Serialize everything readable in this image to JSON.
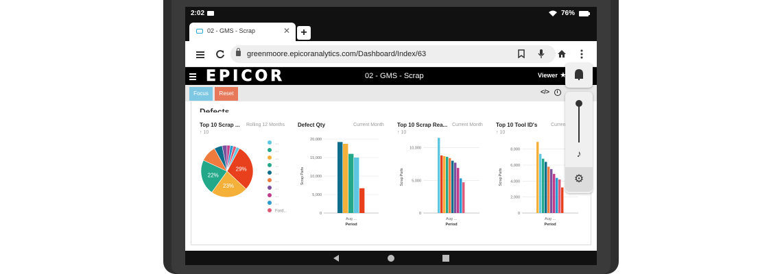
{
  "status": {
    "time": "2:02",
    "battery": "76%"
  },
  "browser": {
    "tab_title": "02 - GMS - Scrap",
    "tab_close": "✕",
    "new_tab": "+",
    "url": "greenmoore.epicoranalytics.com/Dashboard/Index/63"
  },
  "app": {
    "logo": "EPICOR",
    "title": "02 - GMS - Scrap",
    "viewer": "Viewer",
    "focus_label": "Focus",
    "reset_label": "Reset",
    "code_label": "</>"
  },
  "section_title": "Defects",
  "cards": [
    {
      "title": "Top 10 Scrap ...",
      "subtitle": "Rolling 12 Months",
      "count": "10"
    },
    {
      "title": "Defect Qty",
      "subtitle": "Current Month",
      "count": ""
    },
    {
      "title": "Top 10 Scrap Rea...",
      "subtitle": "Current Month",
      "count": "10"
    },
    {
      "title": "Top 10 Tool ID's",
      "subtitle": "Curren",
      "count": "10"
    }
  ],
  "chart_data": [
    {
      "type": "pie",
      "title": "Top 10 Scrap ...",
      "values": [
        29,
        23,
        22,
        10,
        5,
        3,
        2,
        2,
        2,
        2
      ],
      "colors": [
        "#e8401c",
        "#f5b03a",
        "#23a88a",
        "#f07b3f",
        "#0e6e8c",
        "#7d4f9c",
        "#c23b8a",
        "#2a9bd1",
        "#df5a76",
        "#5ec6e0"
      ],
      "data_labels": [
        "29%",
        "23%",
        "22%"
      ],
      "legend": [
        "...",
        "...",
        "...",
        "...",
        "...",
        "...",
        "...",
        "...",
        "...",
        "Ford..."
      ],
      "legend_colors": [
        "#5ec6e0",
        "#23a88a",
        "#f5b03a",
        "#23a88a",
        "#0e6e8c",
        "#f07b3f",
        "#7d4f9c",
        "#c23b8a",
        "#2a9bd1",
        "#df5a76"
      ]
    },
    {
      "type": "bar",
      "title": "Defect Qty",
      "categories": [
        "Aug ..."
      ],
      "values": [
        19200,
        18700,
        16000,
        15000,
        6700
      ],
      "colors": [
        "#0e6e8c",
        "#f5b03a",
        "#23a88a",
        "#5ec6e0",
        "#e8401c"
      ],
      "xlabel": "Period",
      "ylabel": "Scrap Parts",
      "ylim": [
        0,
        20000
      ],
      "yticks": [
        "0",
        "5,000",
        "10,000",
        "15,000",
        "20,000"
      ]
    },
    {
      "type": "bar",
      "title": "Top 10 Scrap Rea...",
      "categories": [
        "Aug ..."
      ],
      "values": [
        11500,
        8800,
        8700,
        8600,
        8400,
        8000,
        7700,
        6900,
        5300,
        4700
      ],
      "colors": [
        "#5ec6e0",
        "#e8401c",
        "#f5b03a",
        "#23a88a",
        "#f07b3f",
        "#0e6e8c",
        "#7d4f9c",
        "#c23b8a",
        "#2a9bd1",
        "#df5a76"
      ],
      "xlabel": "Period",
      "ylabel": "Scrap Parts",
      "ylim": [
        0,
        11000
      ],
      "yticks": [
        "0",
        "5,000",
        "10,000"
      ]
    },
    {
      "type": "bar",
      "title": "Top 10 Tool ID's",
      "categories": [
        "Aug ..."
      ],
      "values": [
        8900,
        7400,
        6800,
        6400,
        5800,
        5500,
        4900,
        4400,
        4200,
        3200
      ],
      "colors": [
        "#f5b03a",
        "#5ec6e0",
        "#23a88a",
        "#0e6e8c",
        "#f07b3f",
        "#7d4f9c",
        "#c23b8a",
        "#2a9bd1",
        "#df5a76",
        "#e8401c"
      ],
      "xlabel": "Period",
      "ylabel": "Scrap Parts",
      "ylim": [
        0,
        9000
      ],
      "yticks": [
        "0",
        "2,000",
        "4,000",
        "6,000",
        "8,000"
      ]
    }
  ]
}
